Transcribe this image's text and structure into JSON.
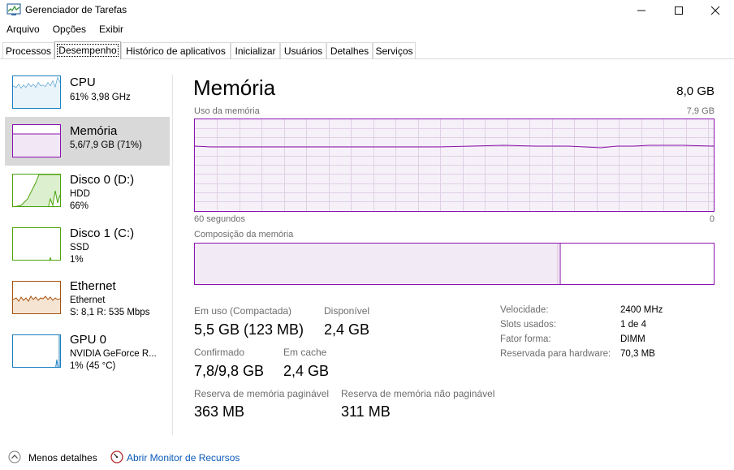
{
  "window": {
    "title": "Gerenciador de Tarefas"
  },
  "menu": [
    "Arquivo",
    "Opções",
    "Exibir"
  ],
  "tabs": [
    "Processos",
    "Desempenho",
    "Histórico de aplicativos",
    "Inicializar",
    "Usuários",
    "Detalhes",
    "Serviços"
  ],
  "active_tab": "Desempenho",
  "sidebar": {
    "items": [
      {
        "title": "CPU",
        "sub1": "61% 3,98 GHz",
        "sub2": "",
        "sub3": "",
        "color": "#1a7fbf"
      },
      {
        "title": "Memória",
        "sub1": "5,6/7,9 GB (71%)",
        "sub2": "",
        "sub3": "",
        "color": "#8b12ae"
      },
      {
        "title": "Disco 0 (D:)",
        "sub1": "HDD",
        "sub2": "66%",
        "sub3": "",
        "color": "#4ca30d"
      },
      {
        "title": "Disco 1 (C:)",
        "sub1": "SSD",
        "sub2": "1%",
        "sub3": "",
        "color": "#4ca30d"
      },
      {
        "title": "Ethernet",
        "sub1": "Ethernet",
        "sub2": "S: 8,1 R: 535 Mbps",
        "sub3": "",
        "color": "#a7530f"
      },
      {
        "title": "GPU 0",
        "sub1": "NVIDIA GeForce R...",
        "sub2": "1% (45 °C)",
        "sub3": "",
        "color": "#1a7fbf"
      }
    ]
  },
  "main": {
    "title": "Memória",
    "total": "8,0 GB",
    "usage_label": "Uso da memória",
    "usage_max": "7,9 GB",
    "time_left": "60 segundos",
    "time_right": "0",
    "composition_label": "Composição da memória",
    "accent": "#8b12ae",
    "usage_fraction": 0.71,
    "composition": {
      "in_use_fraction": 0.7,
      "modified_fraction": 0.005
    }
  },
  "stats": {
    "in_use_label": "Em uso (Compactada)",
    "in_use_value": "5,5 GB (123 MB)",
    "available_label": "Disponível",
    "available_value": "2,4 GB",
    "committed_label": "Confirmado",
    "committed_value": "7,8/9,8 GB",
    "cached_label": "Em cache",
    "cached_value": "2,4 GB",
    "paged_label": "Reserva de memória paginável",
    "paged_value": "363 MB",
    "nonpaged_label": "Reserva de memória não paginável",
    "nonpaged_value": "311 MB"
  },
  "details": [
    {
      "label": "Velocidade:",
      "value": "2400 MHz"
    },
    {
      "label": "Slots usados:",
      "value": "1 de 4"
    },
    {
      "label": "Fator forma:",
      "value": "DIMM"
    },
    {
      "label": "Reservada para hardware:",
      "value": "70,3 MB"
    }
  ],
  "footer": {
    "less_details": "Menos detalhes",
    "resource_monitor": "Abrir Monitor de Recursos"
  }
}
